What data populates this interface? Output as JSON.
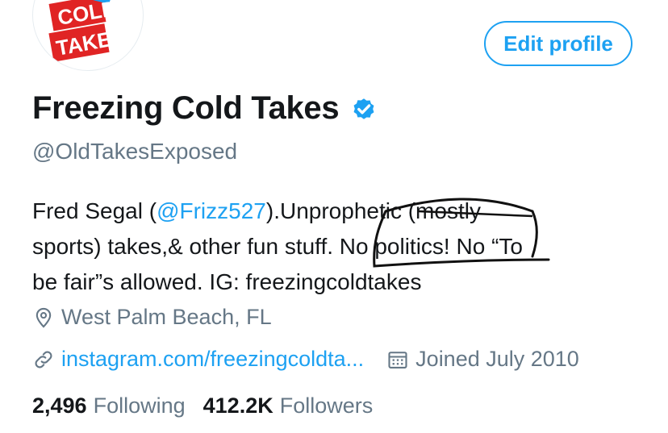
{
  "profile": {
    "avatar_text": [
      "COLD",
      "TAKES"
    ],
    "edit_label": "Edit profile",
    "name": "Freezing Cold Takes",
    "handle": "@OldTakesExposed",
    "bio": {
      "prefix": "Fred Segal (",
      "mention": "@Frizz527",
      "rest1": ").Unprophetic (mostly",
      "line2": "sports) takes,& other fun stuff. No politics! No “To",
      "line3": "be fair”s allowed. IG: freezingcoldtakes"
    },
    "location": "West Palm Beach, FL",
    "website": "instagram.com/freezingcoldta...",
    "joined": "Joined July 2010",
    "following_count": "2,496",
    "following_label": "Following",
    "followers_count": "412.2K",
    "followers_label": "Followers"
  },
  "colors": {
    "accent": "#1da1f2",
    "secondary_text": "#657786",
    "logo_red": "#e02424"
  },
  "icons": [
    "verified-badge-icon",
    "location-pin-icon",
    "link-icon",
    "calendar-icon"
  ]
}
